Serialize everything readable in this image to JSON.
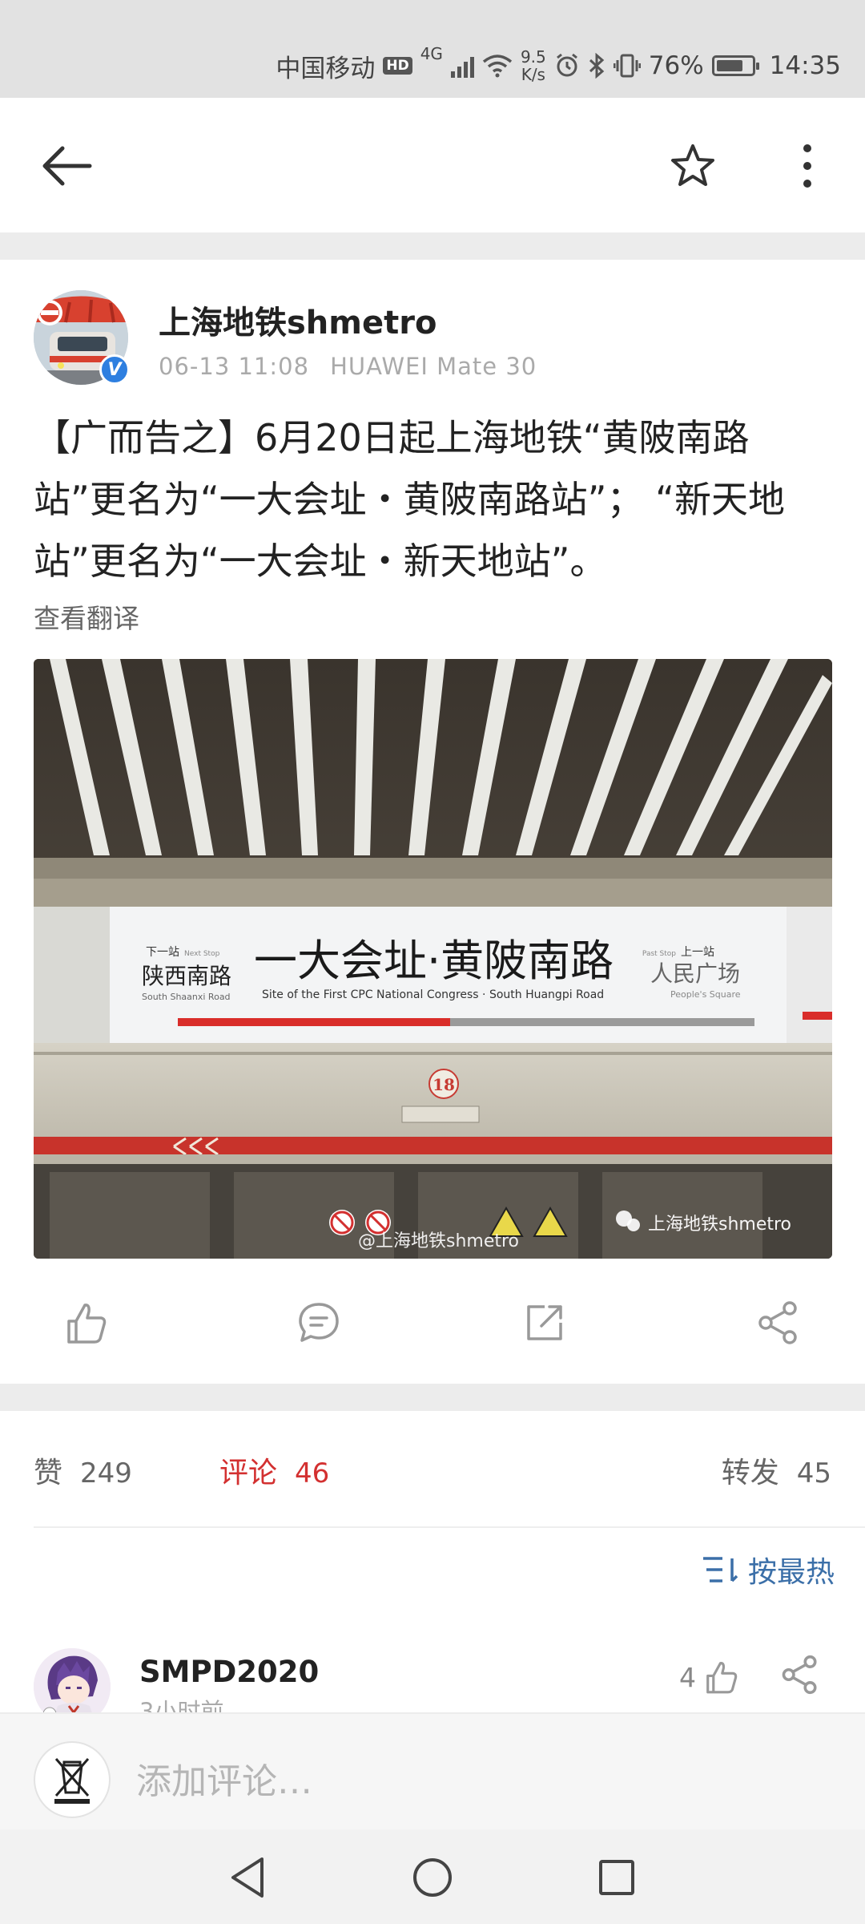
{
  "status_bar": {
    "carrier": "中国移动",
    "hd": "HD",
    "network": "4G",
    "speed_value": "9.5",
    "speed_unit": "K/s",
    "battery_percent": "76%",
    "battery_level": 0.76,
    "time": "14:35"
  },
  "app_bar": {
    "back_icon": "arrow-left-icon",
    "favorite_icon": "star-outline-icon",
    "more_icon": "more-vertical-icon"
  },
  "post": {
    "author": "上海地铁shmetro",
    "date": "06-13 11:08",
    "device": "HUAWEI Mate 30",
    "verified_mark": "V",
    "text": "【广而告之】6月20日起上海地铁“黄陂南路站”更名为“一大会址・黄陂南路站”； “新天地站”更名为“一大会址・新天地站”。",
    "translate_label": "查看翻译",
    "image": {
      "next_label_cn": "下一站",
      "next_label_en": "Next Stop",
      "next_station_cn": "陕西南路",
      "next_station_en": "South Shaanxi Road",
      "station_cn": "一大会址·黄陂南路",
      "station_en": "Site of the First CPC National Congress · South Huangpi Road",
      "prev_label_cn": "上一站",
      "prev_label_en": "Past Stop",
      "prev_station_cn": "人民广场",
      "prev_station_en": "People's Square",
      "door_number": "18",
      "watermark_weibo": "@上海地铁shmetro",
      "watermark_wechat": "上海地铁shmetro"
    }
  },
  "actions": {
    "like_icon": "thumb-up-icon",
    "comment_icon": "comment-icon",
    "repost_icon": "repost-icon",
    "share_icon": "share-icon"
  },
  "stats": {
    "likes_label": "赞",
    "likes_count": "249",
    "comments_label": "评论",
    "comments_count": "46",
    "reposts_label": "转发",
    "reposts_count": "45"
  },
  "sort": {
    "label": "按最热",
    "icon": "sort-icon"
  },
  "comments": [
    {
      "user": "SMPD2020",
      "time": "3小时前",
      "likes": "4"
    }
  ],
  "comment_input": {
    "placeholder": "添加评论…"
  },
  "colors": {
    "accent_red": "#d33030",
    "link_blue": "#3b6fa8",
    "verified_blue": "#2e7fe0"
  }
}
